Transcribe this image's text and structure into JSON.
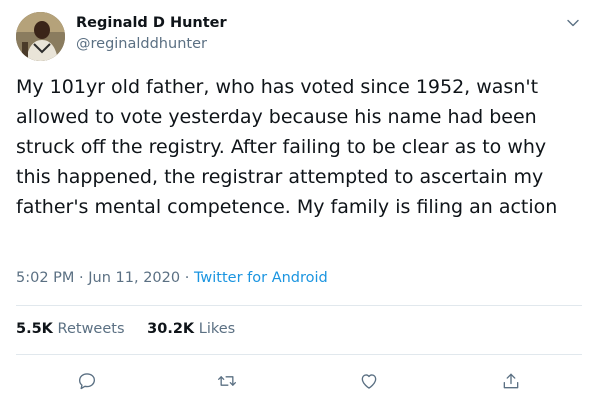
{
  "user": {
    "name": "Reginald D Hunter",
    "handle": "@reginalddhunter"
  },
  "tweet": {
    "text": "My 101yr old father, who has voted since 1952, wasn't allowed to vote yesterday because his name had been struck off the registry. After failing to be clear as to why this happened, the registrar attempted to ascertain my father's mental competence. My family is filing an action",
    "time": "5:02 PM",
    "separator": "·",
    "date": "Jun 11, 2020",
    "source": "Twitter for Android"
  },
  "stats": {
    "retweets_count": "5.5K",
    "retweets_label": "Retweets",
    "likes_count": "30.2K",
    "likes_label": "Likes"
  },
  "icons": {
    "caret": "chevron-down-icon",
    "reply": "reply-icon",
    "retweet": "retweet-icon",
    "like": "heart-icon",
    "share": "share-icon"
  },
  "colors": {
    "text": "#0f1419",
    "secondary": "#5b7083",
    "link": "#1b95e0",
    "divider": "#e1e8ed"
  }
}
